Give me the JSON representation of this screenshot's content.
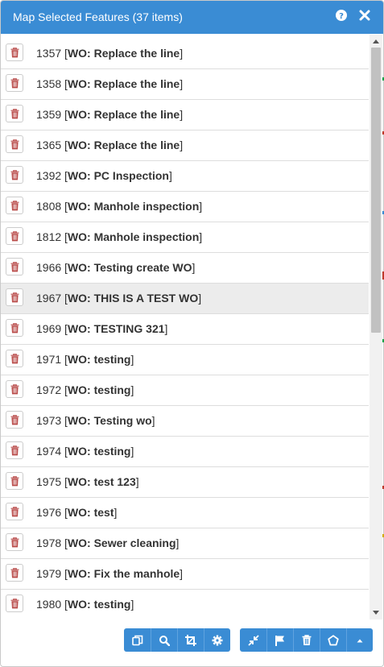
{
  "panel": {
    "title": "Map Selected Features (37 items)",
    "help_icon": "question-circle-icon",
    "close_icon": "close-icon"
  },
  "rows": [
    {
      "id": "1357",
      "wo": "WO: Replace the line",
      "highlighted": false
    },
    {
      "id": "1358",
      "wo": "WO: Replace the line",
      "highlighted": false
    },
    {
      "id": "1359",
      "wo": "WO: Replace the line",
      "highlighted": false
    },
    {
      "id": "1365",
      "wo": "WO: Replace the line",
      "highlighted": false
    },
    {
      "id": "1392",
      "wo": "WO: PC Inspection",
      "highlighted": false
    },
    {
      "id": "1808",
      "wo": "WO: Manhole inspection",
      "highlighted": false
    },
    {
      "id": "1812",
      "wo": "WO: Manhole inspection",
      "highlighted": false
    },
    {
      "id": "1966",
      "wo": "WO: Testing create WO",
      "highlighted": false
    },
    {
      "id": "1967",
      "wo": "WO: THIS IS A TEST WO",
      "highlighted": true
    },
    {
      "id": "1969",
      "wo": "WO: TESTING 321",
      "highlighted": false
    },
    {
      "id": "1971",
      "wo": "WO: testing",
      "highlighted": false
    },
    {
      "id": "1972",
      "wo": "WO: testing",
      "highlighted": false
    },
    {
      "id": "1973",
      "wo": "WO: Testing wo",
      "highlighted": false
    },
    {
      "id": "1974",
      "wo": "WO: testing",
      "highlighted": false
    },
    {
      "id": "1975",
      "wo": "WO: test 123",
      "highlighted": false
    },
    {
      "id": "1976",
      "wo": "WO: test",
      "highlighted": false
    },
    {
      "id": "1978",
      "wo": "WO: Sewer cleaning",
      "highlighted": false
    },
    {
      "id": "1979",
      "wo": "WO: Fix the manhole",
      "highlighted": false
    },
    {
      "id": "1980",
      "wo": "WO: testing",
      "highlighted": false
    }
  ],
  "row_delete_icon": "trash-icon",
  "toolbar": {
    "left_group": [
      "copy-icon",
      "zoom-search-icon",
      "crop-icon",
      "gear-icon"
    ],
    "right_group": [
      "collapse-arrows-icon",
      "flag-icon",
      "trash-icon",
      "pentagon-icon",
      "caret-up-icon"
    ]
  },
  "colors": {
    "header_bg": "#3a8cd4",
    "toolbar_bg": "#3a8cd4",
    "delete_icon": "#b94a48",
    "highlight_row": "#ececec"
  }
}
